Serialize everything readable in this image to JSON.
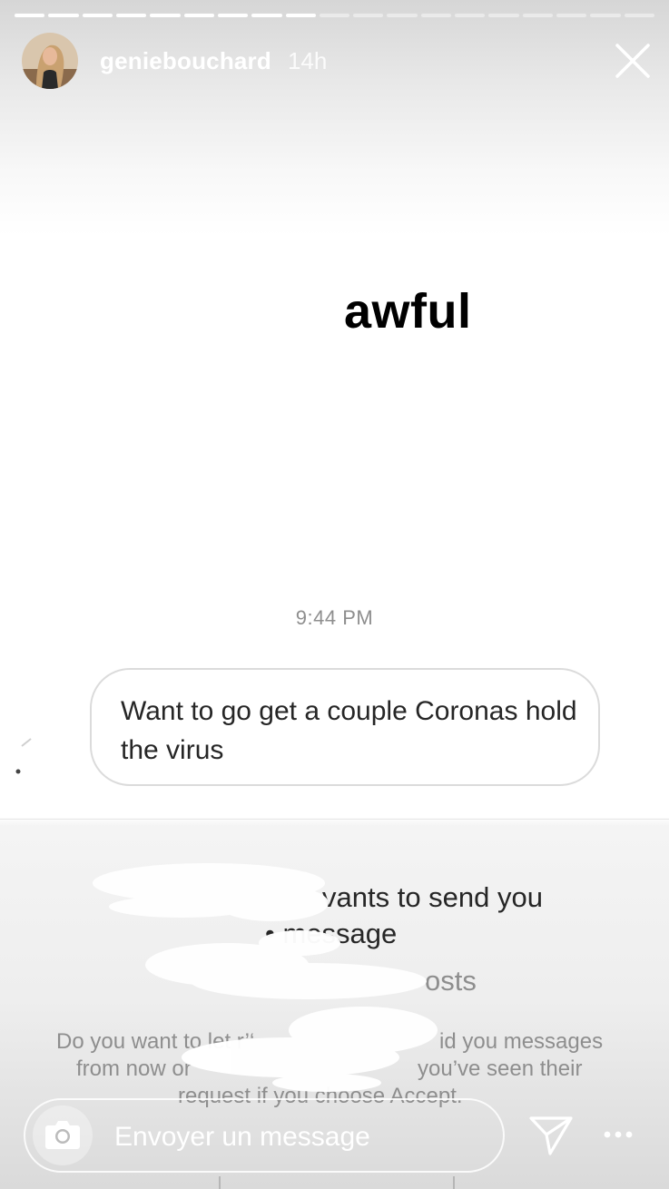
{
  "story": {
    "progress": {
      "segments": 19,
      "completed": 9
    },
    "username": "geniebouchard",
    "time_ago": "14h",
    "caption": "awful"
  },
  "dm": {
    "timestamp": "9:44 PM",
    "message": "Want to go get a couple Coronas hold the virus"
  },
  "request": {
    "line1": "vants to send you",
    "line2": "• message",
    "line3": "osts",
    "info1_left": "Do you want to let r’‘",
    "info1_right": "id you messages",
    "info2_left": "from now or",
    "info2_right": "you’ve seen their",
    "info3": "request if you choose Accept."
  },
  "reply": {
    "placeholder": "Envoyer un message"
  },
  "icons": {
    "close": "close-icon",
    "camera": "camera-icon",
    "send": "send-icon",
    "more": "more-icon"
  },
  "colors": {
    "bubble_border": "#dbdbdb",
    "muted_text": "#8e8e8e",
    "body_text": "#262626"
  }
}
